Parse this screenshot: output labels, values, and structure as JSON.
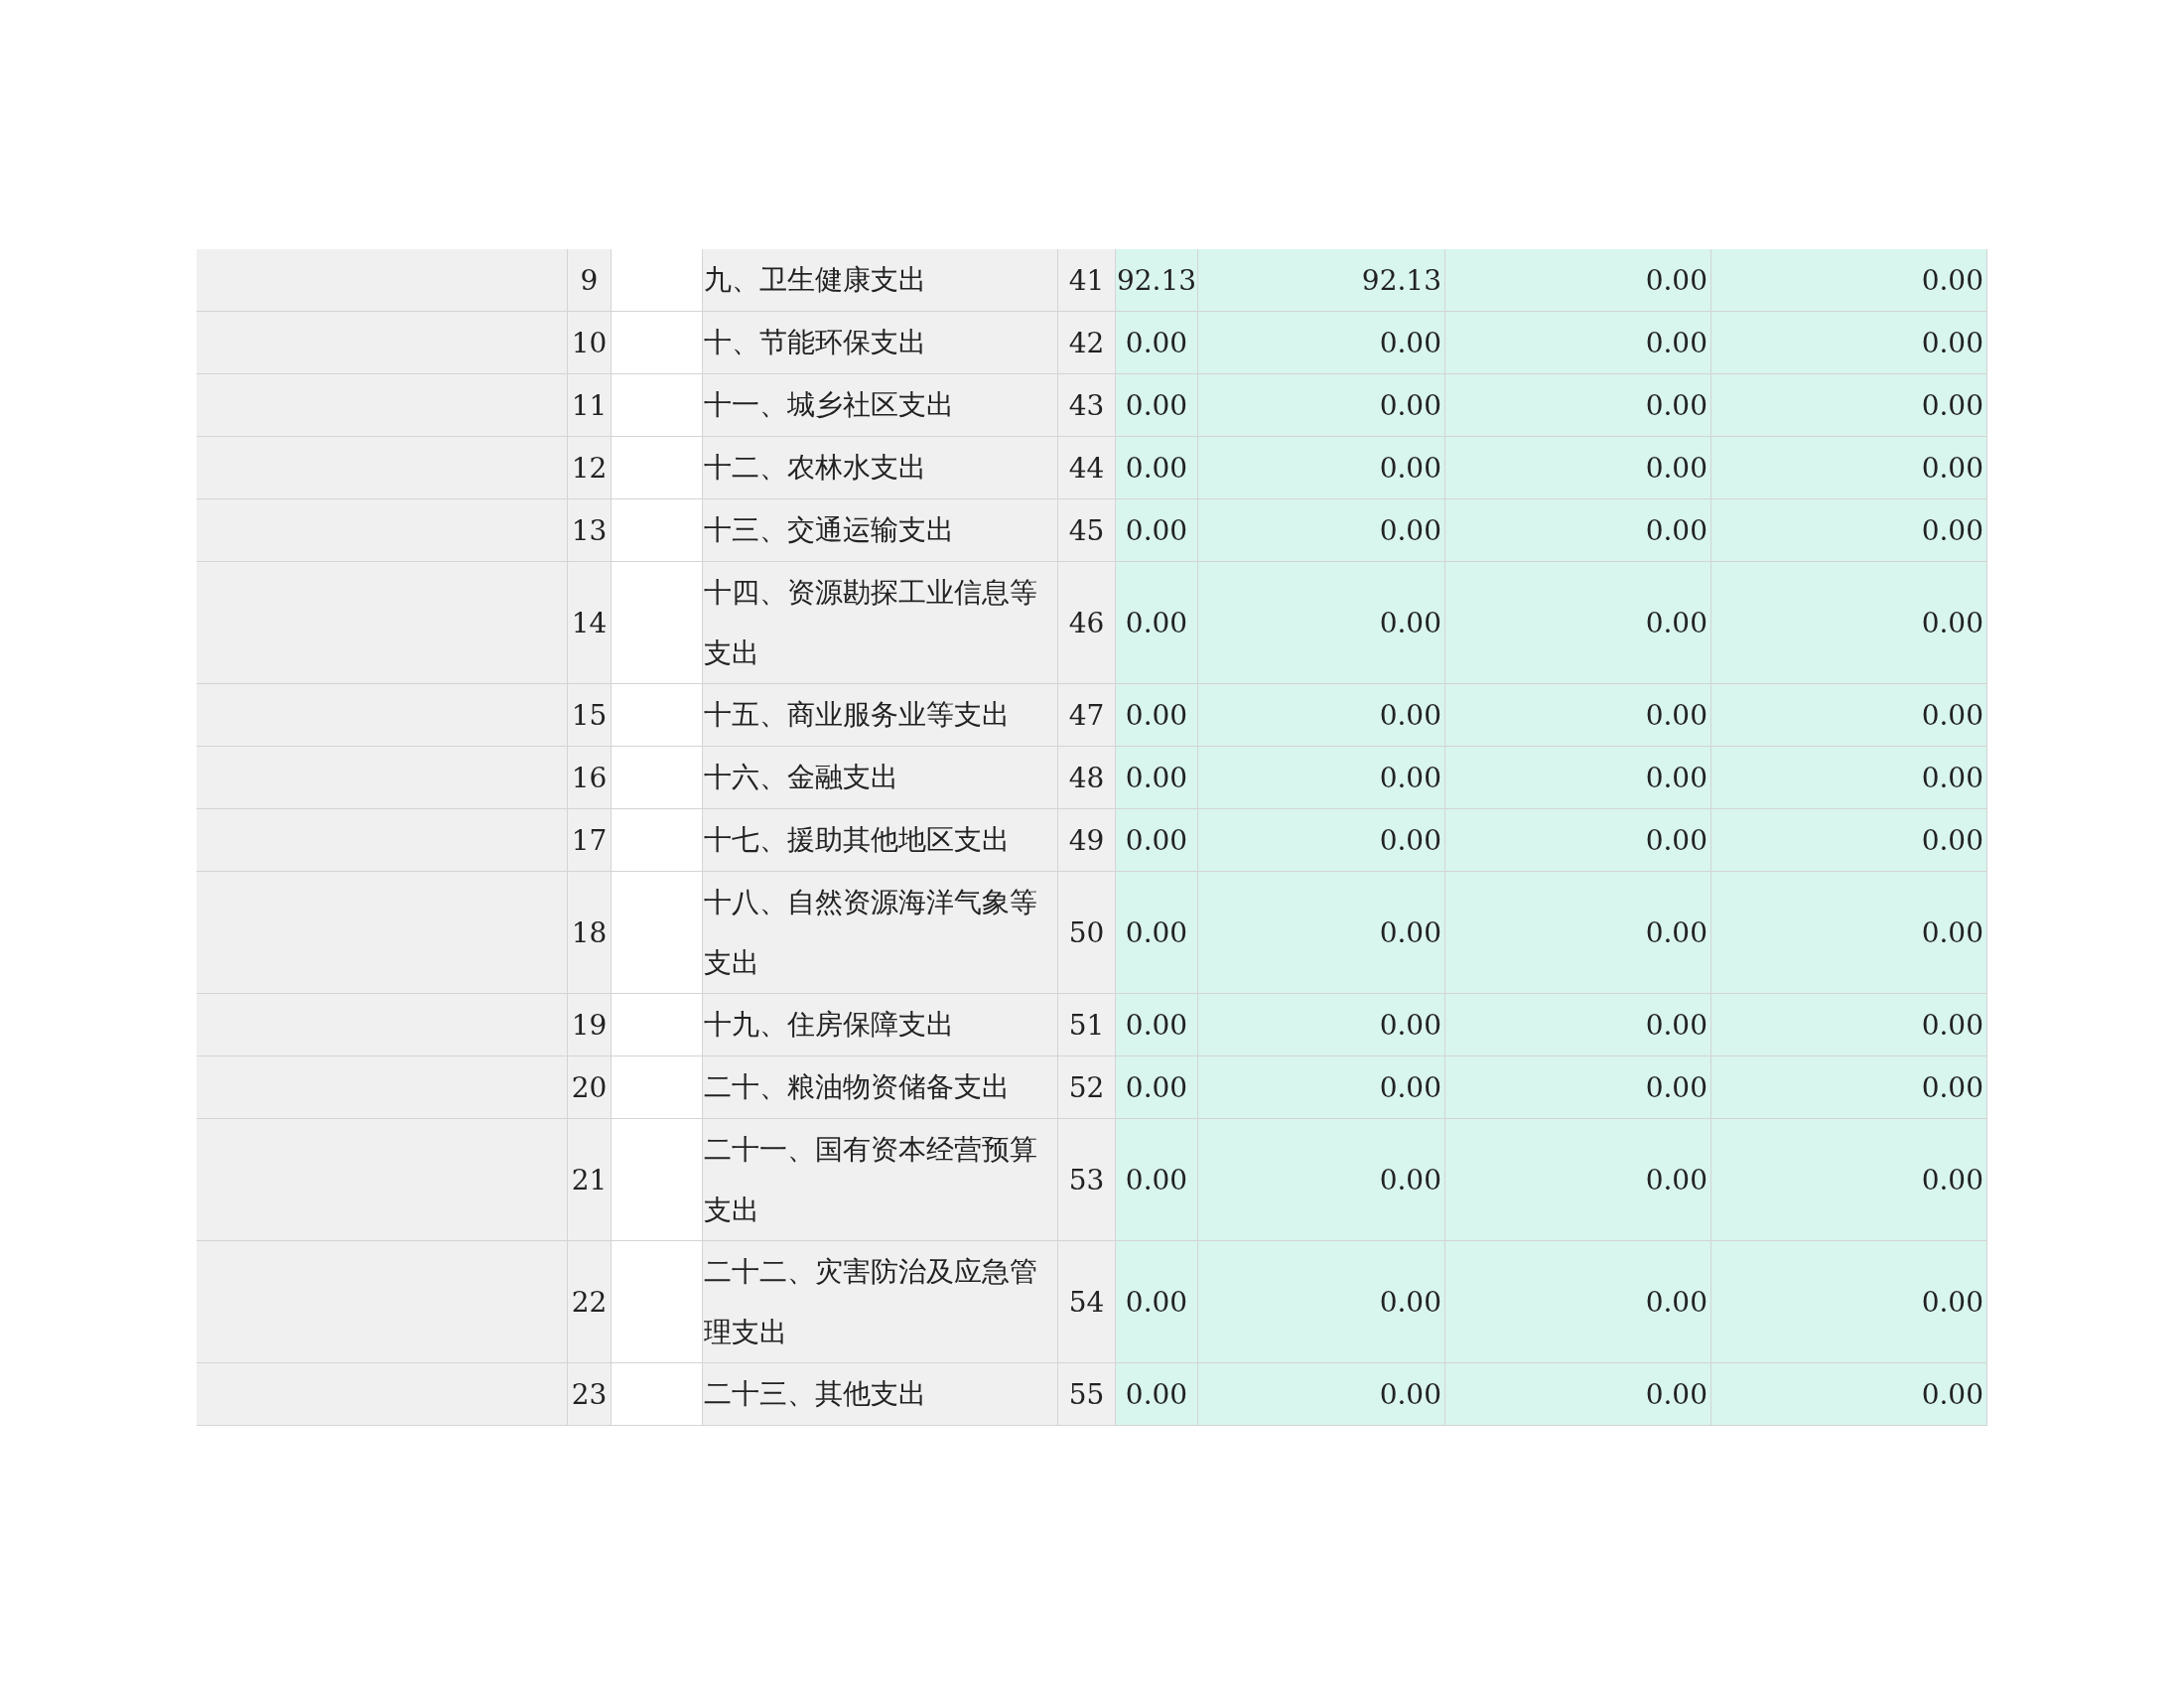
{
  "table": {
    "rows": [
      {
        "index": "9",
        "item": "九、卫生健康支出",
        "line": "41",
        "values": [
          "92.13",
          "92.13",
          "0.00",
          "0.00"
        ]
      },
      {
        "index": "10",
        "item": "十、节能环保支出",
        "line": "42",
        "values": [
          "0.00",
          "0.00",
          "0.00",
          "0.00"
        ]
      },
      {
        "index": "11",
        "item": "十一、城乡社区支出",
        "line": "43",
        "values": [
          "0.00",
          "0.00",
          "0.00",
          "0.00"
        ]
      },
      {
        "index": "12",
        "item": "十二、农林水支出",
        "line": "44",
        "values": [
          "0.00",
          "0.00",
          "0.00",
          "0.00"
        ]
      },
      {
        "index": "13",
        "item": "十三、交通运输支出",
        "line": "45",
        "values": [
          "0.00",
          "0.00",
          "0.00",
          "0.00"
        ]
      },
      {
        "index": "14",
        "item": "十四、资源勘探工业信息等支出",
        "line": "46",
        "values": [
          "0.00",
          "0.00",
          "0.00",
          "0.00"
        ]
      },
      {
        "index": "15",
        "item": "十五、商业服务业等支出",
        "line": "47",
        "values": [
          "0.00",
          "0.00",
          "0.00",
          "0.00"
        ]
      },
      {
        "index": "16",
        "item": "十六、金融支出",
        "line": "48",
        "values": [
          "0.00",
          "0.00",
          "0.00",
          "0.00"
        ]
      },
      {
        "index": "17",
        "item": "十七、援助其他地区支出",
        "line": "49",
        "values": [
          "0.00",
          "0.00",
          "0.00",
          "0.00"
        ]
      },
      {
        "index": "18",
        "item": "十八、自然资源海洋气象等支出",
        "line": "50",
        "values": [
          "0.00",
          "0.00",
          "0.00",
          "0.00"
        ]
      },
      {
        "index": "19",
        "item": "十九、住房保障支出",
        "line": "51",
        "values": [
          "0.00",
          "0.00",
          "0.00",
          "0.00"
        ]
      },
      {
        "index": "20",
        "item": "二十、粮油物资储备支出",
        "line": "52",
        "values": [
          "0.00",
          "0.00",
          "0.00",
          "0.00"
        ]
      },
      {
        "index": "21",
        "item": "二十一、国有资本经营预算支出",
        "line": "53",
        "values": [
          "0.00",
          "0.00",
          "0.00",
          "0.00"
        ]
      },
      {
        "index": "22",
        "item": "二十二、灾害防治及应急管理支出",
        "line": "54",
        "values": [
          "0.00",
          "0.00",
          "0.00",
          "0.00"
        ]
      },
      {
        "index": "23",
        "item": "二十三、其他支出",
        "line": "55",
        "values": [
          "0.00",
          "0.00",
          "0.00",
          "0.00"
        ]
      }
    ]
  }
}
